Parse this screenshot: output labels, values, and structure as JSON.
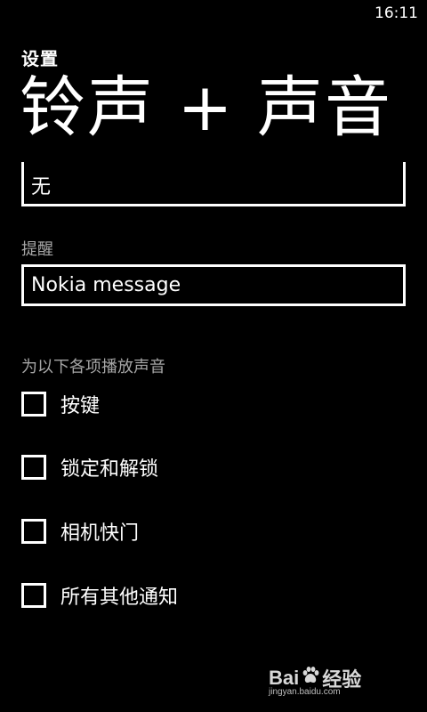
{
  "status_bar": {
    "time": "16:11"
  },
  "header": {
    "app_title": "设置",
    "page_title": "铃声 + 声音"
  },
  "ringtone": {
    "value": "无"
  },
  "reminder": {
    "label": "提醒",
    "value": "Nokia message"
  },
  "sounds_section": {
    "label": "为以下各项播放声音",
    "items": [
      {
        "label": "按键",
        "checked": false
      },
      {
        "label": "锁定和解锁",
        "checked": false
      },
      {
        "label": "相机快门",
        "checked": false
      },
      {
        "label": "所有其他通知",
        "checked": false
      }
    ]
  },
  "watermark": {
    "brand_left": "Bai",
    "brand_right": "经验",
    "url": "jingyan.baidu.com",
    "icon": "baidu-paw-icon"
  }
}
